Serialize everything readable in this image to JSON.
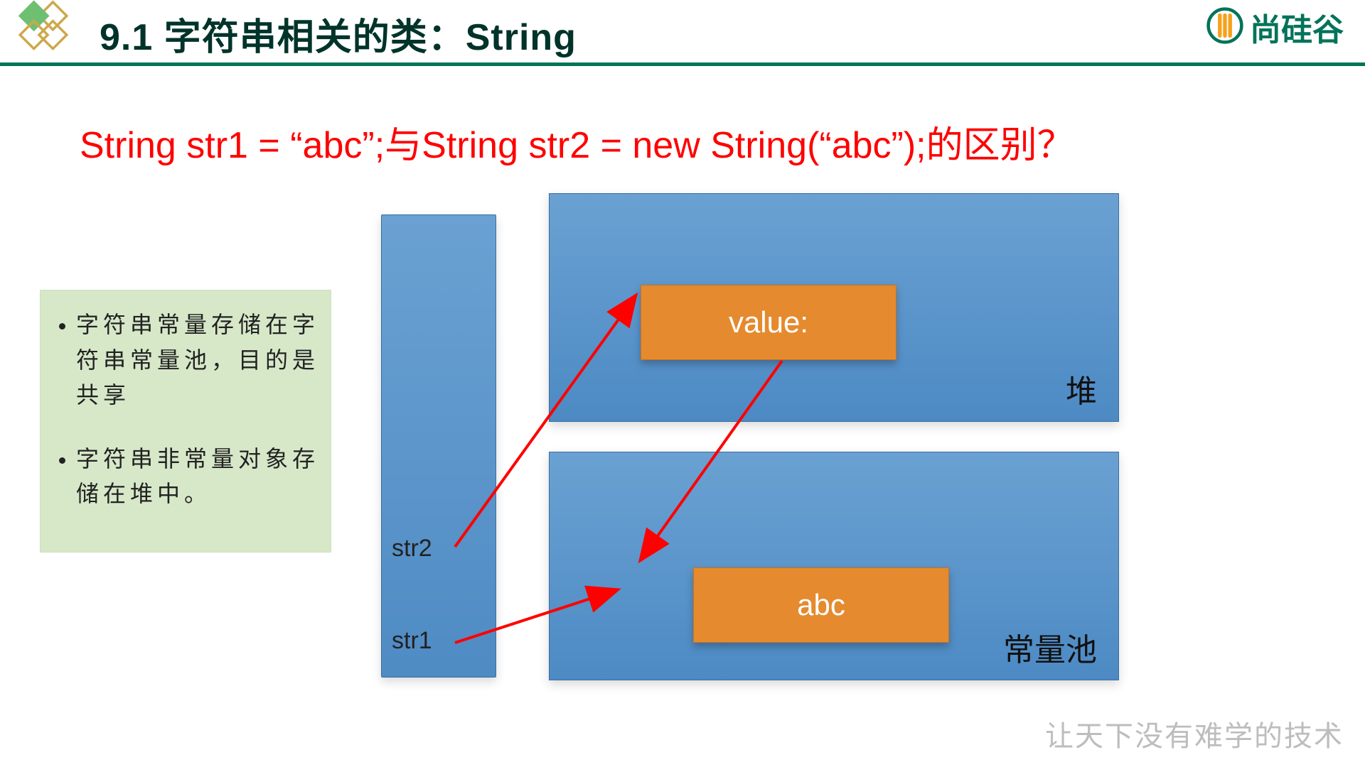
{
  "header": {
    "title": "9.1 字符串相关的类：String",
    "brand": "尚硅谷"
  },
  "question": "String str1  = “abc”;与String str2 = new String(“abc”);的区别？",
  "notes": {
    "item1": "字符串常量存储在字符串常量池，目的是共享",
    "item2": "字符串非常量对象存储在堆中。"
  },
  "stack": {
    "str2": "str2",
    "str1": "str1"
  },
  "heap": {
    "label": "堆",
    "value_box": "value:"
  },
  "pool": {
    "label": "常量池",
    "abc_box": "abc"
  },
  "slogan": "让天下没有难学的技术",
  "colors": {
    "accent_green": "#00735a",
    "panel_blue": "#5a92c9",
    "box_orange": "#e58a2e",
    "arrow_red": "#ff0000",
    "note_bg": "#d7e8c9"
  }
}
